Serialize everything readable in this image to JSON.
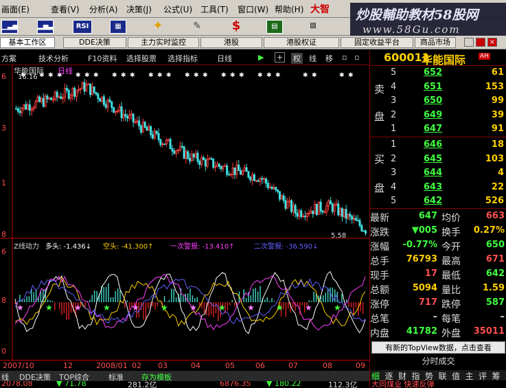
{
  "menu": {
    "items": [
      "画面(E)",
      "查看(V)",
      "分析(A)",
      "决策(J)",
      "公式(U)",
      "工具(T)",
      "窗口(W)",
      "帮助(H)"
    ],
    "brand": "大智"
  },
  "toolbar": {
    "rsi_label": "RSI",
    "s_label": "$"
  },
  "watermark": {
    "line1": "炒股輔助教材58股网",
    "line2": "www.58Gu.com"
  },
  "tabs": [
    "基本工作区",
    "DDE决策",
    "主力实时监控",
    "港股",
    "港股权证",
    "固定收益平台",
    "商品市场"
  ],
  "funcbar": {
    "items": [
      "方案",
      "技术分析",
      "F10资料",
      "选择股票",
      "选择指标",
      "日线",
      "权",
      "线",
      "移"
    ]
  },
  "chart": {
    "stock_title": "华能国际",
    "period": "日线",
    "price_axis": [
      "6",
      "3",
      "1",
      "8"
    ],
    "max_label": "16.16",
    "min_label": "5.58",
    "indicator": {
      "name": "Z线动力",
      "items": [
        {
          "label": "多头: -1.436↓",
          "color": "#ffffff"
        },
        {
          "label": "空头: -41.300↑",
          "color": "#ffd000"
        },
        {
          "label": "一次警报: -13.410↑",
          "color": "#ff40ff"
        },
        {
          "label": "二次警报: -36.590↓",
          "color": "#6060ff"
        }
      ],
      "axis": [
        "6",
        "8",
        "0"
      ]
    }
  },
  "chart_data": {
    "type": "line",
    "title": "华能国际 日线",
    "x": [
      "2007/10",
      "12",
      "2008/01",
      "02",
      "03",
      "04",
      "05",
      "06",
      "07",
      "08",
      "09"
    ],
    "series": [
      {
        "name": "华能国际",
        "values": [
          14.5,
          15.2,
          16.16,
          14.2,
          12.4,
          10.9,
          10.1,
          9.4,
          6.8,
          7.3,
          5.58
        ]
      }
    ],
    "ylim": [
      5,
      17
    ],
    "min_label": 5.58,
    "max_label": 16.16
  },
  "dates": [
    "2007/10",
    "12",
    "2008/01",
    "02",
    "03",
    "04",
    "05",
    "06",
    "07",
    "08",
    "09"
  ],
  "bottom_tabs": [
    "线",
    "DDE决策",
    "TOP综合",
    "标准",
    "存为模板"
  ],
  "index_strip": [
    {
      "text": "2078.08",
      "color": "#ff5050"
    },
    {
      "text": "▼ 71.78",
      "color": "#40ff40"
    },
    {
      "text": "281.2亿",
      "color": "#ddd"
    },
    {
      "text": "6876.35",
      "color": "#ff5050"
    },
    {
      "text": "▼ 180.22",
      "color": "#40ff40"
    },
    {
      "text": "112.3亿",
      "color": "#ddd"
    }
  ],
  "quote": {
    "code": "600011",
    "name": "华能国际",
    "ah_badge": "AH",
    "sell_label": [
      "卖",
      "盘"
    ],
    "buy_label": [
      "买",
      "盘"
    ],
    "sell": [
      {
        "idx": "5",
        "price": "652",
        "vol": "61"
      },
      {
        "idx": "4",
        "price": "651",
        "vol": "153"
      },
      {
        "idx": "3",
        "price": "650",
        "vol": "99"
      },
      {
        "idx": "2",
        "price": "649",
        "vol": "39"
      },
      {
        "idx": "1",
        "price": "647",
        "vol": "91"
      }
    ],
    "buy": [
      {
        "idx": "1",
        "price": "646",
        "vol": "18"
      },
      {
        "idx": "2",
        "price": "645",
        "vol": "103"
      },
      {
        "idx": "3",
        "price": "644",
        "vol": "4"
      },
      {
        "idx": "4",
        "price": "643",
        "vol": "22"
      },
      {
        "idx": "5",
        "price": "642",
        "vol": "526"
      }
    ],
    "stats": [
      {
        "l1": "最新",
        "v1": "647",
        "c1": "#40ff40",
        "l2": "均价",
        "v2": "663",
        "c2": "#ff5050"
      },
      {
        "l1": "涨跌",
        "v1": "▼005",
        "c1": "#40ff40",
        "l2": "换手",
        "v2": "0.27%",
        "c2": "#ffd000"
      },
      {
        "l1": "涨幅",
        "v1": "-0.77%",
        "c1": "#40ff40",
        "l2": "今开",
        "v2": "650",
        "c2": "#40ff40"
      },
      {
        "l1": "总手",
        "v1": "76793",
        "c1": "#ffd000",
        "l2": "最高",
        "v2": "671",
        "c2": "#ff5050"
      },
      {
        "l1": "现手",
        "v1": "17",
        "c1": "#ff5050",
        "l2": "最低",
        "v2": "642",
        "c2": "#40ff40"
      },
      {
        "l1": "总额",
        "v1": "5094",
        "c1": "#ffd000",
        "l2": "量比",
        "v2": "1.59",
        "c2": "#ffd000"
      },
      {
        "l1": "涨停",
        "v1": "717",
        "c1": "#ff5050",
        "l2": "跌停",
        "v2": "587",
        "c2": "#40ff40"
      },
      {
        "l1": "总笔",
        "v1": "–",
        "c1": "#ddd",
        "l2": "每笔",
        "v2": "–",
        "c2": "#ddd"
      },
      {
        "l1": "内盘",
        "v1": "41782",
        "c1": "#40ff40",
        "l2": "外盘",
        "v2": "35011",
        "c2": "#ff5050"
      }
    ],
    "notice": "有新的TopView数据，点击查看",
    "notice2": "分时成交",
    "right_tabs": [
      "细",
      "逐",
      "财",
      "指",
      "势",
      "联",
      "值",
      "主",
      "评",
      "筹"
    ],
    "footer": "大同煤业 快速反弹"
  },
  "colors": {
    "up": "#ff5050",
    "down": "#40ff40",
    "accent": "#ffd000",
    "border": "#800000"
  }
}
